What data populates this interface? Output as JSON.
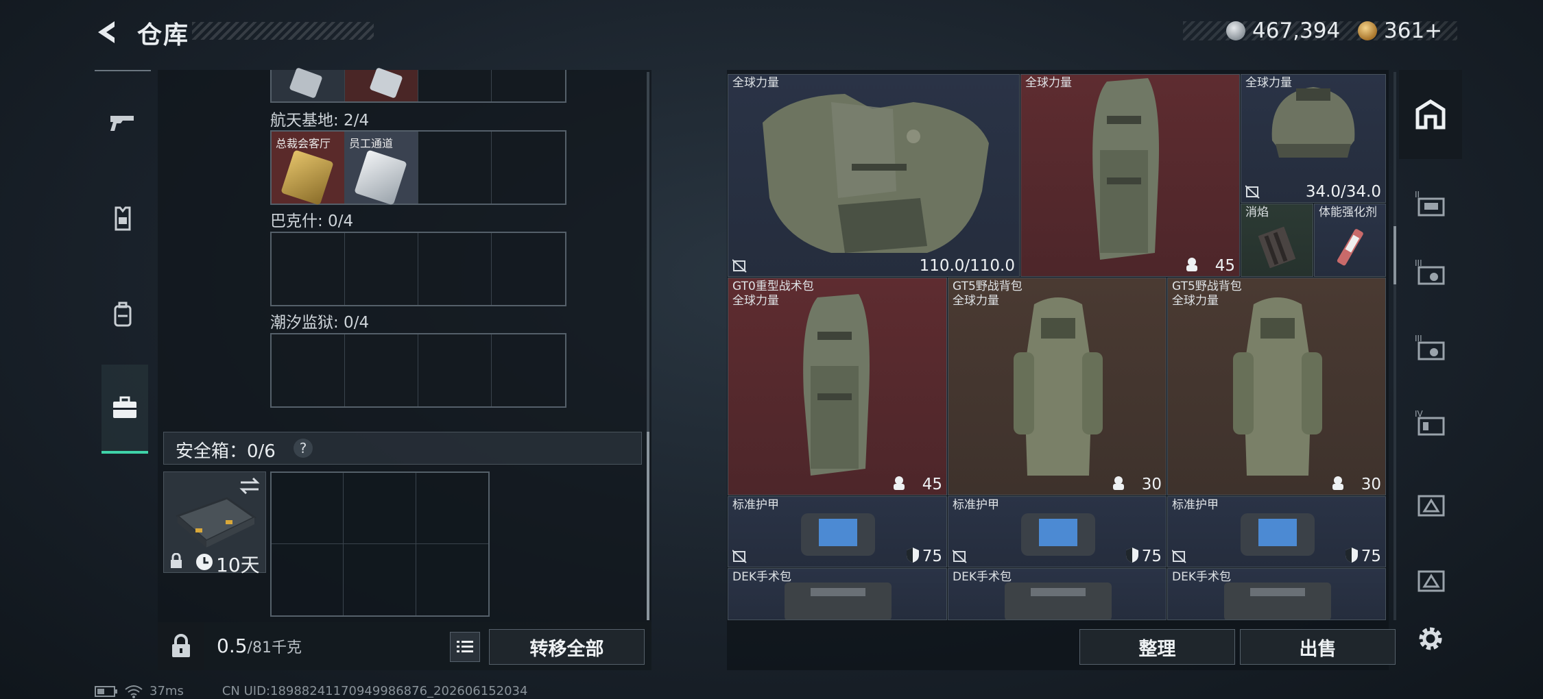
{
  "header": {
    "title": "仓库"
  },
  "currency": {
    "silver": "467,394",
    "gold": "361+"
  },
  "left": {
    "sections": [
      {
        "label": "航天基地: 2/4",
        "keys": [
          "总裁会客厅",
          "员工通道"
        ]
      },
      {
        "label": "巴克什: 0/4"
      },
      {
        "label": "潮汐监狱: 0/4"
      }
    ],
    "safe_label": "安全箱：0/6",
    "safe_help": "?",
    "safe_time": "10天",
    "weight_value": "0.5",
    "weight_max": "/81千克",
    "transfer_all": "转移全部"
  },
  "right": {
    "tiles": [
      {
        "name": "全球力量",
        "value": "110.0/110.0"
      },
      {
        "name": "全球力量",
        "value": "45"
      },
      {
        "name": "全球力量",
        "value": "34.0/34.0"
      },
      {
        "name": "消焰",
        "value": ""
      },
      {
        "name": "体能强化剂",
        "value": ""
      },
      {
        "name": "GT0重型战术包\n全球力量",
        "value": "45"
      },
      {
        "name": "GT5野战背包\n全球力量",
        "value": "30"
      },
      {
        "name": "GT5野战背包\n全球力量",
        "value": "30"
      },
      {
        "name": "标准护甲",
        "value": "75"
      },
      {
        "name": "标准护甲",
        "value": "75"
      },
      {
        "name": "标准护甲",
        "value": "75"
      },
      {
        "name": "DEK手术包",
        "value": ""
      },
      {
        "name": "DEK手术包",
        "value": ""
      },
      {
        "name": "DEK手术包",
        "value": ""
      }
    ],
    "sort_button": "整理",
    "sell_button": "出售"
  },
  "status": {
    "ping": "37ms",
    "uid": "CN UID:18988241170949986876_202606152034"
  },
  "colors": {
    "accent": "#3fd3a8",
    "red_tile": "#5e2c30",
    "blue_tile": "#2a3346",
    "brown_tile": "#4a3a32"
  }
}
